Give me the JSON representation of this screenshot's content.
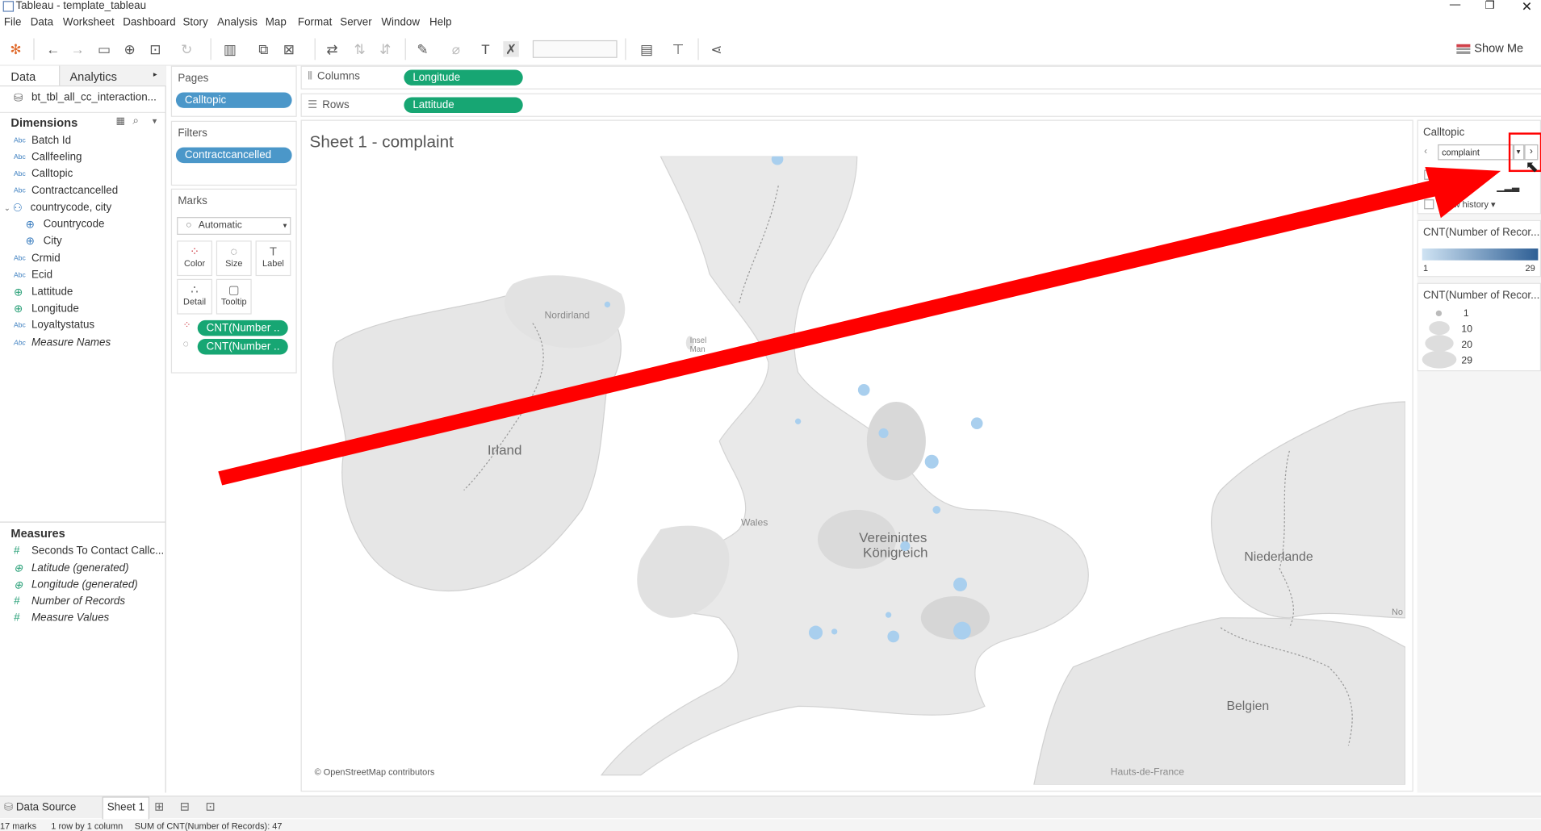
{
  "window": {
    "title": "Tableau - template_tableau"
  },
  "menu": [
    "File",
    "Data",
    "Worksheet",
    "Dashboard",
    "Story",
    "Analysis",
    "Map",
    "Format",
    "Server",
    "Window",
    "Help"
  ],
  "toolbar": {
    "show_me": "Show Me"
  },
  "data_pane": {
    "tab_data": "Data",
    "tab_analytics": "Analytics",
    "datasource": "bt_tbl_all_cc_interaction...",
    "dimensions_title": "Dimensions",
    "dimensions": [
      {
        "type": "Abc",
        "label": "Batch Id"
      },
      {
        "type": "Abc",
        "label": "Callfeeling"
      },
      {
        "type": "Abc",
        "label": "Calltopic"
      },
      {
        "type": "Abc",
        "label": "Contractcancelled"
      },
      {
        "type": "hier",
        "label": "countrycode, city"
      },
      {
        "type": "geo",
        "label": "Countrycode"
      },
      {
        "type": "geo",
        "label": "City"
      },
      {
        "type": "Abc",
        "label": "Crmid"
      },
      {
        "type": "Abc",
        "label": "Ecid"
      },
      {
        "type": "geo",
        "label": "Lattitude"
      },
      {
        "type": "geo",
        "label": "Longitude"
      },
      {
        "type": "Abc",
        "label": "Loyaltystatus"
      },
      {
        "type": "Abc",
        "label": "Measure Names"
      }
    ],
    "measures_title": "Measures",
    "measures": [
      {
        "type": "#",
        "label": "Seconds To Contact Callc..."
      },
      {
        "type": "geo",
        "label": "Latitude (generated)"
      },
      {
        "type": "geo",
        "label": "Longitude (generated)"
      },
      {
        "type": "#",
        "label": "Number of Records"
      },
      {
        "type": "#",
        "label": "Measure Values"
      }
    ]
  },
  "pages": {
    "title": "Pages",
    "pill": "Calltopic"
  },
  "filters": {
    "title": "Filters",
    "pill": "Contractcancelled"
  },
  "marks": {
    "title": "Marks",
    "type": "Automatic",
    "buttons": [
      "Color",
      "Size",
      "Label",
      "Detail",
      "Tooltip"
    ],
    "pills": [
      "CNT(Number ..",
      "CNT(Number .."
    ]
  },
  "shelves": {
    "columns_label": "Columns",
    "columns_pill": "Longitude",
    "rows_label": "Rows",
    "rows_pill": "Lattitude"
  },
  "view": {
    "sheet_title": "Sheet 1 - complaint",
    "copyright": "© OpenStreetMap contributors",
    "map_labels": {
      "nordirland": "Nordirland",
      "insel": "Insel",
      "man": "Man",
      "irland": "Irland",
      "wales": "Wales",
      "uk1": "Vereinigtes",
      "uk2": "Königreich",
      "niederlande": "Niederlande",
      "belgien": "Belgien",
      "hauts": "Hauts-de-France",
      "no": "No"
    }
  },
  "legends": {
    "page_card_title": "Calltopic",
    "page_value": "complaint",
    "show_history": "Show history",
    "color_title": "CNT(Number of Recor...",
    "color_min": "1",
    "color_max": "29",
    "size_title": "CNT(Number of Recor...",
    "size_values": [
      "1",
      "10",
      "20",
      "29"
    ]
  },
  "sheet_tabs": {
    "data_source": "Data Source",
    "sheet1": "Sheet 1"
  },
  "status": {
    "marks": "17 marks",
    "rows": "1 row by 1 column",
    "sum": "SUM of CNT(Number of Records): 47"
  },
  "colors": {
    "pill_blue": "#4b97c9",
    "pill_green": "#17a673",
    "annotation_red": "#ff0000",
    "dot_blue": "#a9cfee"
  }
}
